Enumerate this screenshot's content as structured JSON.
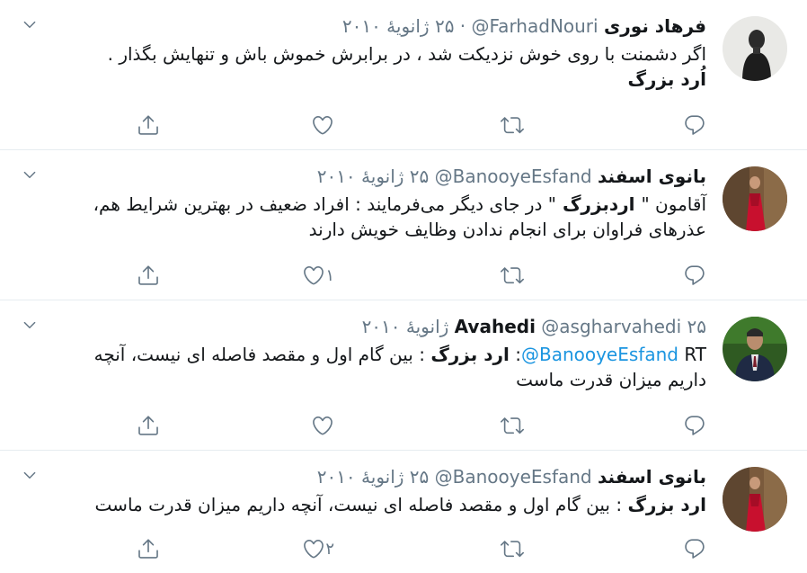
{
  "tweets": [
    {
      "name": "فرهاد نوری",
      "handle": "@FarhadNouri",
      "date": "۲۵ ژانویهٔ ۲۰۱۰",
      "lines": [
        "اگر دشمنت با روی خوش نزدیکت شد ، در برابرش خموش باش و تنهایش بگذار .",
        "اُرد بزرگ"
      ],
      "like_count": ""
    },
    {
      "name": "بانوی اسفند",
      "handle": "@BanooyeEsfand",
      "date": "۲۵ ژانویهٔ ۲۰۱۰",
      "text_prefix": "آقامون \"",
      "text_bold": " اردبزرگ ",
      "text_suffix": "\" در جای دیگر می‌فرمایند : افراد ضعیف در بهترین شرایط هم،",
      "text_line2": "عذرهای فراوان برای انجام ندادن وظایف خویش دارند",
      "like_count": "۱"
    },
    {
      "name": "Avahedi",
      "handle": "@asgharvahedi",
      "date": "۲۵ ژانویهٔ ۲۰۱۰",
      "rt": "RT",
      "mention": "@BanooyeEsfand",
      "text_bold": "ارد بزرگ",
      "text_suffix": ": بین گام اول و مقصد فاصله ای نیست، آنچه",
      "text_line2": "داریم میزان قدرت ماست",
      "like_count": ""
    },
    {
      "name": "بانوی اسفند",
      "handle": "@BanooyeEsfand",
      "date": "۲۵ ژانویهٔ ۲۰۱۰",
      "text_bold": "ارد بزرگ",
      "text_suffix": ": بین گام اول و مقصد فاصله ای نیست، آنچه داریم میزان قدرت ماست",
      "like_count": "۲"
    }
  ],
  "icons": {
    "reply": "reply-icon",
    "retweet": "retweet-icon",
    "like": "heart-icon",
    "share": "share-icon",
    "caret": "chevron-down-icon"
  },
  "colors": {
    "icon": "#657786",
    "link": "#1b95e0",
    "divider": "#e6ecf0",
    "text": "#14171a"
  }
}
